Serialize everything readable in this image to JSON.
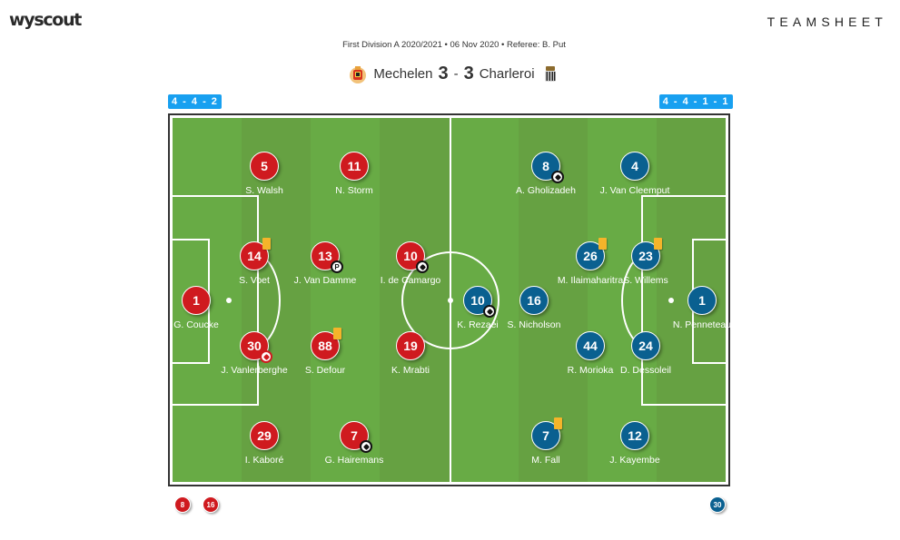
{
  "header": {
    "logo": "wyscout",
    "title": "TEAMSHEET"
  },
  "match": {
    "info": "First Division A 2020/2021 • 06 Nov 2020 • Referee: B. Put",
    "home_team": "Mechelen",
    "away_team": "Charleroi",
    "home_score": "3",
    "separator": "-",
    "away_score": "3",
    "home_crest": "mechelen-crest-icon",
    "away_crest": "charleroi-crest-icon"
  },
  "colors": {
    "home": "#cf1a1f",
    "away": "#0a6090",
    "formation_badge": "#18a0f0",
    "pitch_light": "#68ab45",
    "pitch_dark": "#66a142",
    "yellow_card": "#f5b42a"
  },
  "home": {
    "formation": "4 - 4 - 2",
    "players": [
      {
        "number": "1",
        "name": "G. Coucke",
        "events": []
      },
      {
        "number": "14",
        "name": "S. Voet",
        "events": [
          "yellow-card"
        ]
      },
      {
        "number": "30",
        "name": "J. Vanlerberghe",
        "events": [
          "own-goal"
        ]
      },
      {
        "number": "13",
        "name": "J. Van Damme",
        "events": [
          "penalty-goal"
        ]
      },
      {
        "number": "88",
        "name": "S. Defour",
        "events": [
          "yellow-card"
        ]
      },
      {
        "number": "10",
        "name": "I. de Camargo",
        "events": [
          "goal"
        ]
      },
      {
        "number": "19",
        "name": "K. Mrabti",
        "events": []
      },
      {
        "number": "5",
        "name": "S. Walsh",
        "events": []
      },
      {
        "number": "11",
        "name": "N. Storm",
        "events": []
      },
      {
        "number": "29",
        "name": "I. Kaboré",
        "events": []
      },
      {
        "number": "7",
        "name": "G. Hairemans",
        "events": [
          "goal"
        ]
      }
    ],
    "subs": [
      "8",
      "16"
    ]
  },
  "away": {
    "formation": "4 - 4 - 1 - 1",
    "players": [
      {
        "number": "1",
        "name": "N. Penneteau",
        "events": []
      },
      {
        "number": "23",
        "name": "S. Willems",
        "events": [
          "yellow-card"
        ]
      },
      {
        "number": "24",
        "name": "D. Dessoleil",
        "events": []
      },
      {
        "number": "26",
        "name": "M. Ilaimaharitra",
        "events": [
          "yellow-card"
        ]
      },
      {
        "number": "44",
        "name": "R. Morioka",
        "events": []
      },
      {
        "number": "4",
        "name": "J. Van Cleemput",
        "events": []
      },
      {
        "number": "12",
        "name": "J. Kayembe",
        "events": []
      },
      {
        "number": "8",
        "name": "A. Gholizadeh",
        "events": [
          "goal"
        ]
      },
      {
        "number": "7",
        "name": "M. Fall",
        "events": [
          "yellow-card"
        ]
      },
      {
        "number": "16",
        "name": "S. Nicholson",
        "events": []
      },
      {
        "number": "10",
        "name": "K. Rezaei",
        "events": [
          "goal"
        ]
      }
    ],
    "subs": [
      "30"
    ]
  }
}
